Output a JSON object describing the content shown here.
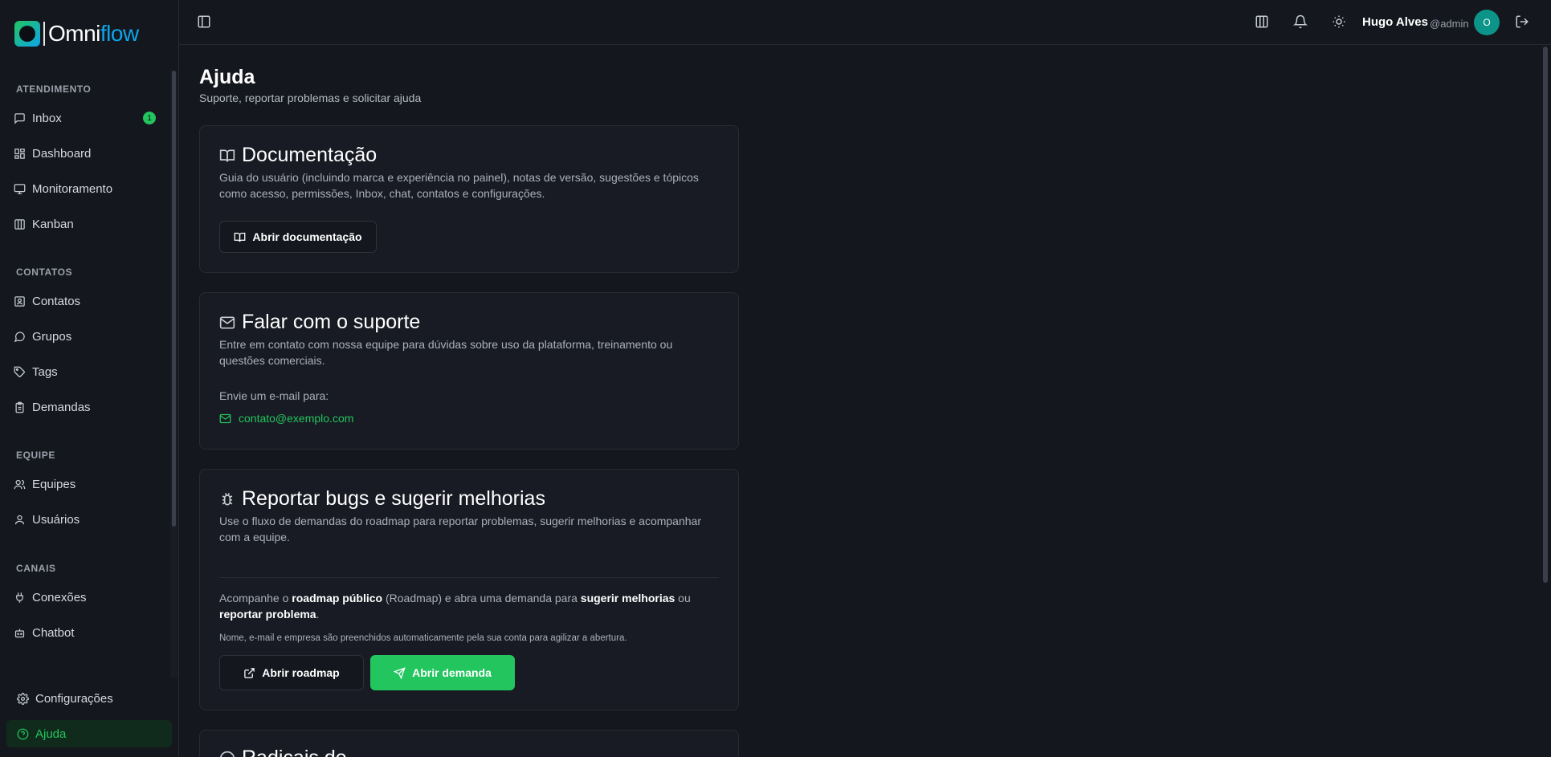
{
  "app": {
    "brand_first": "Omni",
    "brand_second": "flow"
  },
  "sidebar": {
    "sections": [
      {
        "label": "ATENDIMENTO"
      },
      {
        "label": "CONTATOS"
      },
      {
        "label": "EQUIPE"
      },
      {
        "label": "CANAIS"
      }
    ],
    "items": [
      {
        "label": "Inbox",
        "badge": "1",
        "icon": "message-square-icon"
      },
      {
        "label": "Dashboard",
        "icon": "layout-grid-icon"
      },
      {
        "label": "Monitoramento",
        "icon": "monitor-icon"
      },
      {
        "label": "Kanban",
        "icon": "kanban-icon"
      },
      {
        "label": "Contatos",
        "icon": "contact-card-icon"
      },
      {
        "label": "Grupos",
        "icon": "message-circle-icon"
      },
      {
        "label": "Tags",
        "icon": "tag-icon"
      },
      {
        "label": "Demandas",
        "icon": "clipboard-icon"
      },
      {
        "label": "Equipes",
        "icon": "users-icon"
      },
      {
        "label": "Usuários",
        "icon": "user-icon"
      },
      {
        "label": "Conexões",
        "icon": "plug-icon"
      },
      {
        "label": "Chatbot",
        "icon": "bot-icon"
      },
      {
        "label": "Configurações",
        "icon": "gear-icon"
      },
      {
        "label": "Ajuda",
        "icon": "help-circle-icon",
        "active": true
      }
    ]
  },
  "topbar": {
    "user_name": "Hugo Alves",
    "user_handle": "@admin",
    "avatar_initial": "O"
  },
  "page": {
    "title": "Ajuda",
    "subtitle": "Suporte, reportar problemas e solicitar ajuda"
  },
  "cards": {
    "docs": {
      "title": "Documentação",
      "description": "Guia do usuário (incluindo marca e experiência no painel), notas de versão, sugestões e tópicos como acesso, permissões, Inbox, chat, contatos e configurações.",
      "button": "Abrir documentação"
    },
    "support": {
      "title": "Falar com o suporte",
      "description": "Entre em contato com nossa equipe para dúvidas sobre uso da plataforma, treinamento ou questões comerciais.",
      "email_label": "Envie um e-mail para:",
      "email": "contato@exemplo.com"
    },
    "bugs": {
      "title": "Reportar bugs e sugerir melhorias",
      "description": "Use o fluxo de demandas do roadmap para reportar problemas, sugerir melhorias e acompanhar com a equipe.",
      "text_1": "Acompanhe o ",
      "text_roadmap": "roadmap público",
      "text_2": " (Roadmap) e abra uma demanda para ",
      "text_suggest": "sugerir melhorias",
      "text_3": " ou ",
      "text_report": "reportar problema",
      "text_4": ".",
      "note": "Nome, e-mail e empresa são preenchidos automaticamente pela sua conta para agilizar a abertura.",
      "button_roadmap": "Abrir roadmap",
      "button_demand": "Abrir demanda"
    },
    "next": {
      "title": "Radicais de"
    }
  },
  "colors": {
    "accent": "#22c55e",
    "background": "#14171e",
    "card": "#181b23"
  }
}
